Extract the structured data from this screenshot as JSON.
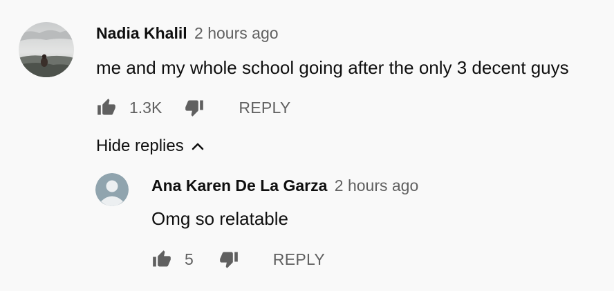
{
  "comment": {
    "author": "Nadia Khalil",
    "time": "2 hours ago",
    "text": "me and my whole school going after the only 3 decent guys",
    "like_count": "1.3K",
    "reply_label": "REPLY",
    "like_icon": "thumbs-up-icon",
    "dislike_icon": "thumbs-down-icon"
  },
  "replies_toggle": {
    "label": "Hide replies",
    "icon": "chevron-up-icon"
  },
  "reply": {
    "author": "Ana Karen De La Garza",
    "time": "2 hours ago",
    "text": "Omg so relatable",
    "like_count": "5",
    "reply_label": "REPLY",
    "avatar_icon": "default-avatar-icon"
  },
  "colors": {
    "background": "#f9f9f9",
    "text_primary": "#0f0f0f",
    "text_secondary": "#606060",
    "generic_avatar": "#90a4ae"
  }
}
